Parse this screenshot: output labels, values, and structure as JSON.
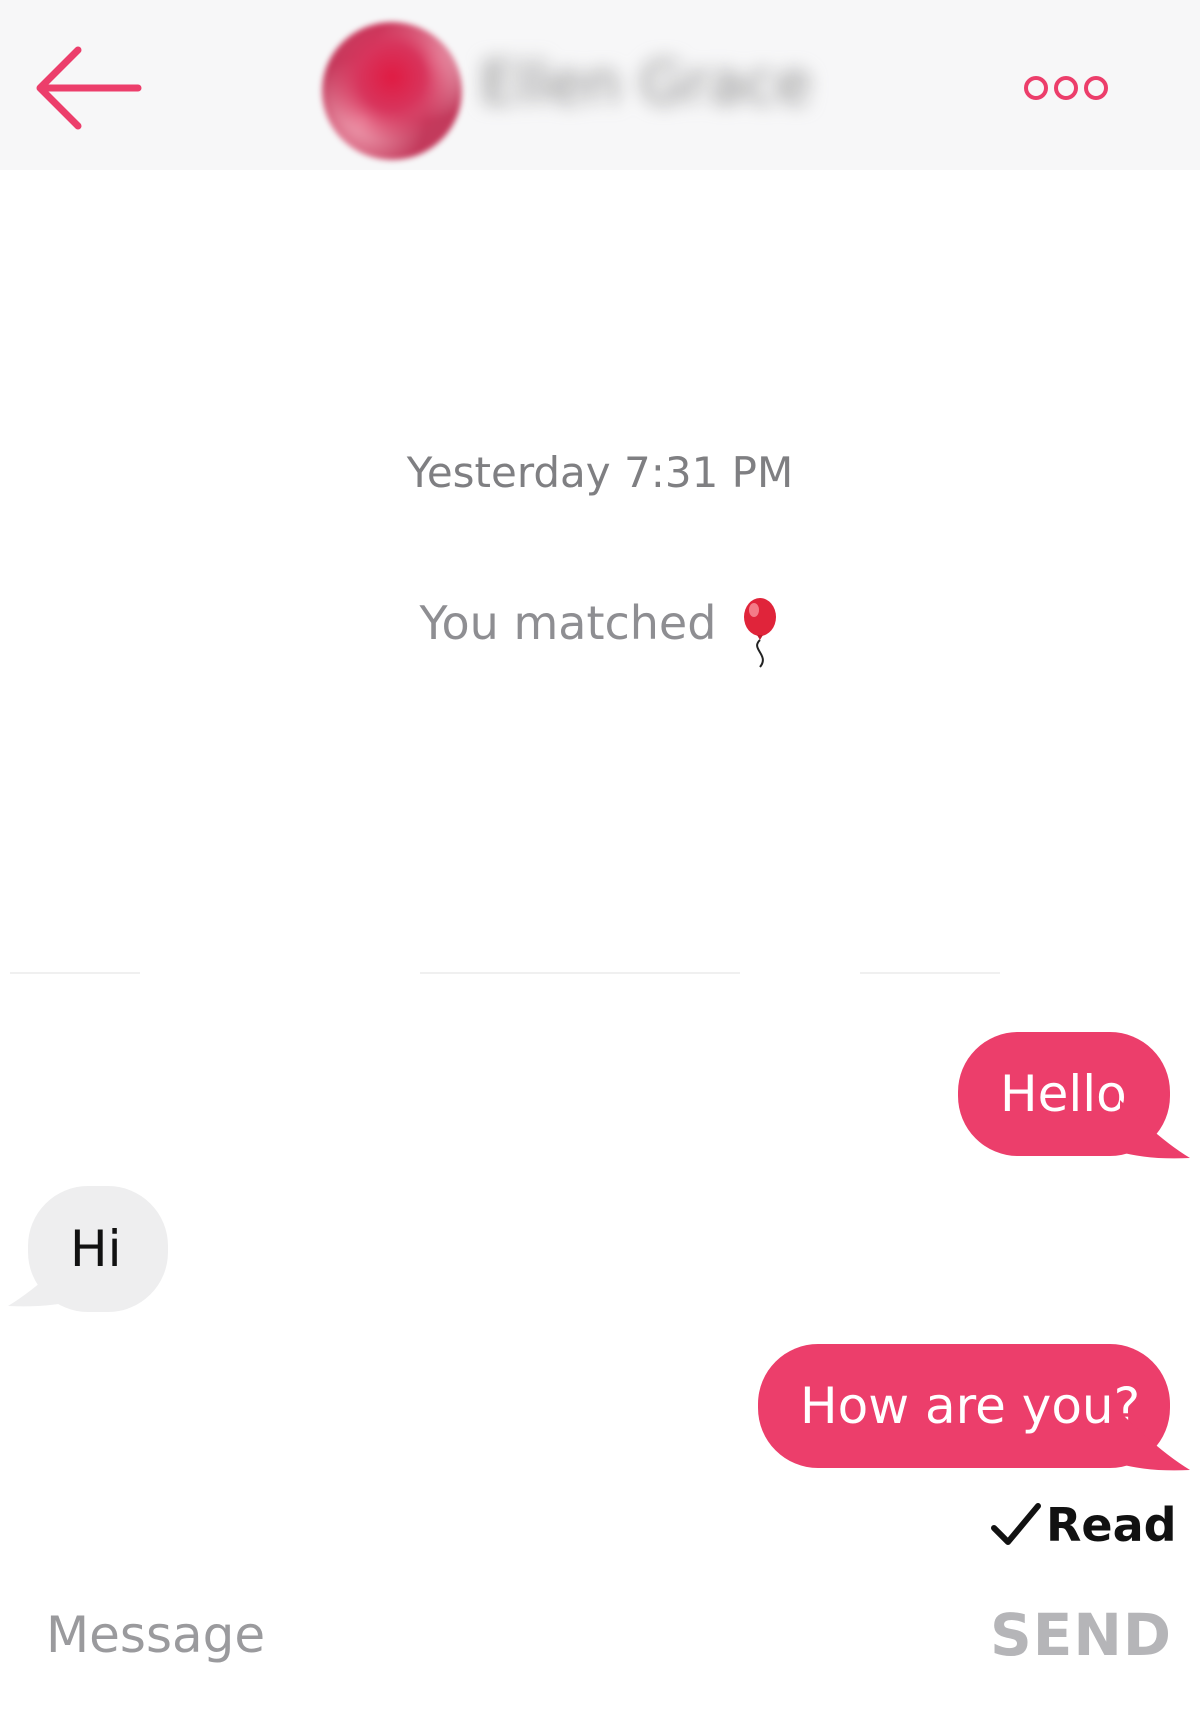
{
  "header": {
    "contact_name": "Ellen Grace",
    "back_icon": "arrow-left-icon",
    "more_icon": "more-options-icon"
  },
  "conversation": {
    "timestamp": "Yesterday 7:31 PM",
    "match_notice": "You matched",
    "match_icon": "balloon-icon",
    "messages": [
      {
        "direction": "outgoing",
        "text": "Hello"
      },
      {
        "direction": "incoming",
        "text": "Hi"
      },
      {
        "direction": "outgoing",
        "text": "How are you?"
      }
    ],
    "read_receipt": "Read"
  },
  "composer": {
    "placeholder": "Message",
    "send_label": "SEND"
  },
  "colors": {
    "accent": "#ec3e6b",
    "incoming_bubble": "#eeeeef",
    "header_bg": "#f7f7f8",
    "muted_text": "#8e8e92"
  }
}
